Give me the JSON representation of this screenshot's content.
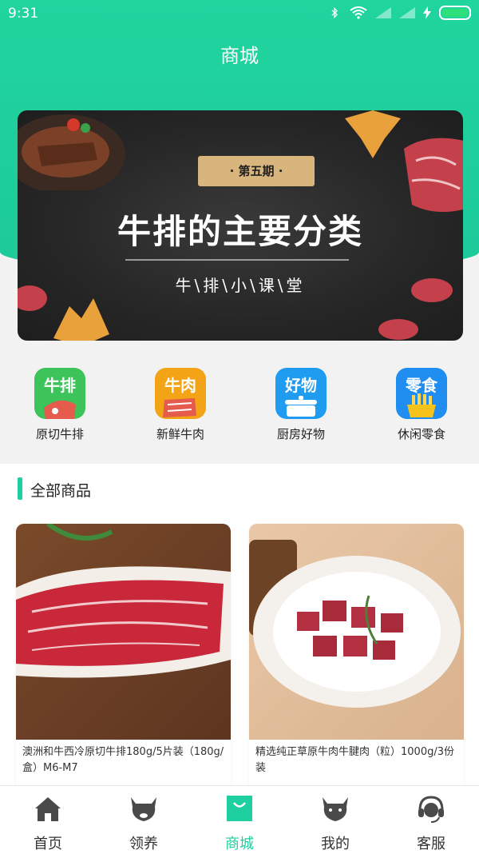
{
  "status_bar": {
    "time": "9:31"
  },
  "header": {
    "title": "商城"
  },
  "banner": {
    "issue": "· 第五期 ·",
    "title": "牛排的主要分类",
    "subtitle": "牛\\排\\小\\课\\堂"
  },
  "categories": [
    {
      "icon_text": "牛排",
      "label": "原切牛排",
      "color": "#3cc45a"
    },
    {
      "icon_text": "牛肉",
      "label": "新鲜牛肉",
      "color": "#f3a316"
    },
    {
      "icon_text": "好物",
      "label": "厨房好物",
      "color": "#1f9bf0"
    },
    {
      "icon_text": "零食",
      "label": "休闲零食",
      "color": "#1f8ef0"
    }
  ],
  "section": {
    "title": "全部商品"
  },
  "products": [
    {
      "name": "澳洲和牛西冷原切牛排180g/5片装（180g/盒）M6-M7"
    },
    {
      "name": "精选纯正草原牛肉牛腱肉（粒）1000g/3份装"
    }
  ],
  "tabs": [
    {
      "label": "首页",
      "icon": "home-icon"
    },
    {
      "label": "领养",
      "icon": "cow-icon"
    },
    {
      "label": "商城",
      "icon": "shopping-bag-icon"
    },
    {
      "label": "我的",
      "icon": "profile-cow-icon"
    },
    {
      "label": "客服",
      "icon": "headset-icon"
    }
  ],
  "colors": {
    "accent": "#1ecf9f",
    "banner_gold": "#d8b57c"
  }
}
